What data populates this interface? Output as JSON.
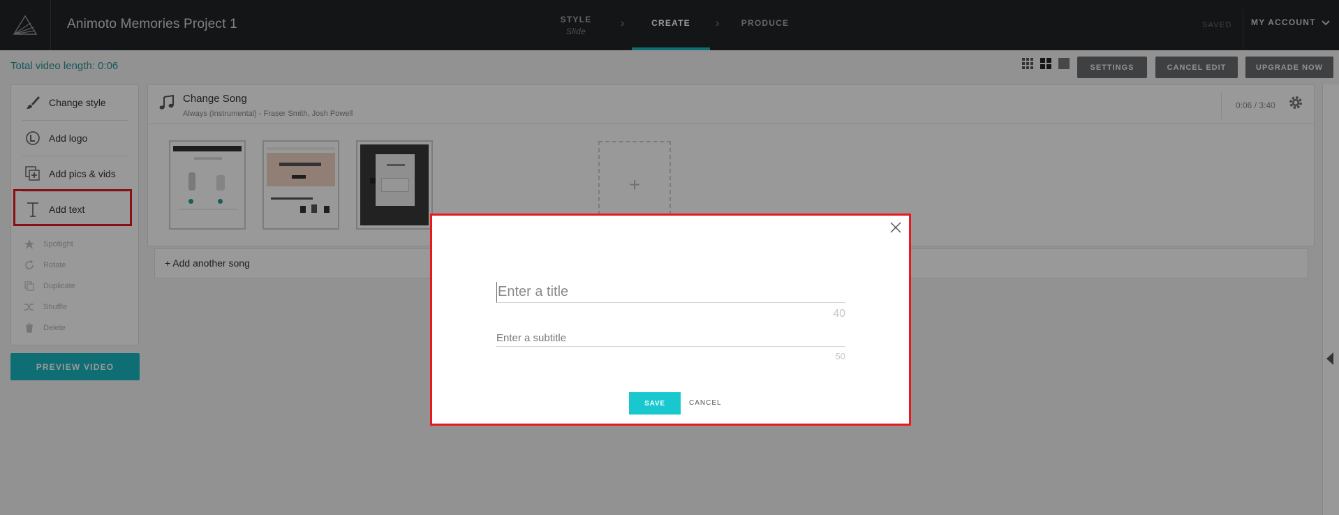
{
  "header": {
    "project_title": "Animoto Memories Project 1",
    "steps": [
      {
        "label": "STYLE",
        "sub": "Slide"
      },
      {
        "label": "CREATE"
      },
      {
        "label": "PRODUCE"
      }
    ],
    "saved_label": "SAVED",
    "account_label": "MY ACCOUNT",
    "accent_color": "#19b8c0"
  },
  "toolbar": {
    "video_length": "Total video length: 0:06",
    "view_icons": [
      "grid-small-icon",
      "grid-large-icon",
      "single-view-icon"
    ],
    "settings_label": "SETTINGS",
    "cancel_edit_label": "CANCEL EDIT",
    "upgrade_label": "UPGRADE NOW"
  },
  "sidebar": {
    "items": [
      {
        "label": "Change style",
        "icon": "brush-icon"
      },
      {
        "label": "Add logo",
        "icon": "logo-icon"
      },
      {
        "label": "Add pics & vids",
        "icon": "add-media-icon"
      },
      {
        "label": "Add text",
        "icon": "text-icon"
      }
    ],
    "sub_items": [
      {
        "label": "Spotlight",
        "icon": "star-icon"
      },
      {
        "label": "Rotate",
        "icon": "rotate-icon"
      },
      {
        "label": "Duplicate",
        "icon": "duplicate-icon"
      },
      {
        "label": "Shuffle",
        "icon": "shuffle-icon"
      },
      {
        "label": "Delete",
        "icon": "trash-icon"
      }
    ],
    "preview_label": "PREVIEW VIDEO"
  },
  "song": {
    "title": "Change Song",
    "subtitle": "Always (Instrumental) - Fraser Smith, Josh Powell",
    "time": "0:06 / 3:40"
  },
  "slides": {
    "add_label": "+"
  },
  "add_song_label": "+ Add another song",
  "modal": {
    "title_placeholder": "Enter a title",
    "title_limit": "40",
    "subtitle_placeholder": "Enter a subtitle",
    "subtitle_limit": "50",
    "save_label": "SAVE",
    "cancel_label": "CANCEL"
  }
}
